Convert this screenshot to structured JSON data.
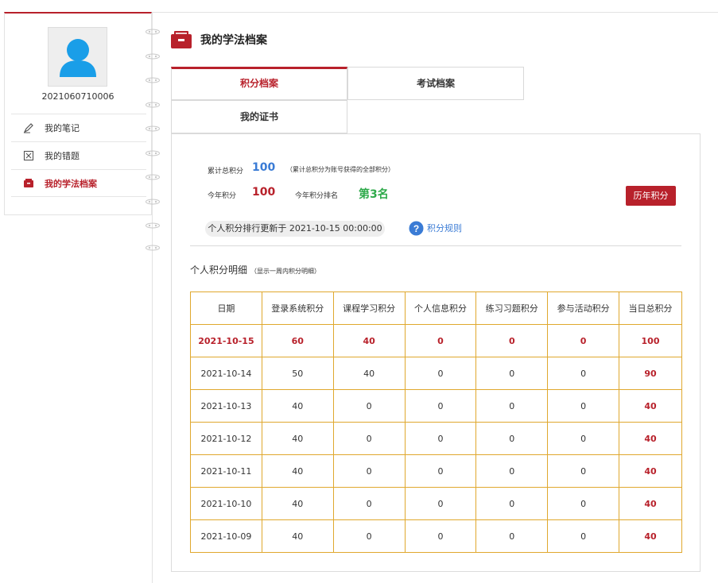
{
  "sidebar": {
    "user_id": "2021060710006",
    "menu": [
      {
        "label": "我的笔记",
        "icon": "pen-icon"
      },
      {
        "label": "我的错题",
        "icon": "wrong-answer-icon"
      },
      {
        "label": "我的学法档案",
        "icon": "archive-box-icon"
      }
    ],
    "active_index": 2
  },
  "header": {
    "title": "我的学法档案",
    "icon": "archive-box-icon"
  },
  "tabs": [
    {
      "label": "积分档案",
      "active": true
    },
    {
      "label": "考试档案",
      "active": false
    },
    {
      "label": "我的证书",
      "active": false
    }
  ],
  "stats": {
    "total_label": "累计总积分",
    "total_value": "100",
    "total_note": "（累计总积分为账号获得的全部积分）",
    "year_label": "今年积分",
    "year_value": "100",
    "rank_label": "今年积分排名",
    "rank_value": "第3名",
    "history_button": "历年积分",
    "update_text": "个人积分排行更新于  2021-10-15  00:00:00",
    "rule_link": "积分规则"
  },
  "detail": {
    "title": "个人积分明细",
    "subtitle": "（显示一周内积分明细）",
    "columns": [
      "日期",
      "登录系统积分",
      "课程学习积分",
      "个人信息积分",
      "练习习题积分",
      "参与活动积分",
      "当日总积分"
    ],
    "rows": [
      [
        "2021-10-15",
        "60",
        "40",
        "0",
        "0",
        "0",
        "100"
      ],
      [
        "2021-10-14",
        "50",
        "40",
        "0",
        "0",
        "0",
        "90"
      ],
      [
        "2021-10-13",
        "40",
        "0",
        "0",
        "0",
        "0",
        "40"
      ],
      [
        "2021-10-12",
        "40",
        "0",
        "0",
        "0",
        "0",
        "40"
      ],
      [
        "2021-10-11",
        "40",
        "0",
        "0",
        "0",
        "0",
        "40"
      ],
      [
        "2021-10-10",
        "40",
        "0",
        "0",
        "0",
        "0",
        "40"
      ],
      [
        "2021-10-09",
        "40",
        "0",
        "0",
        "0",
        "0",
        "40"
      ]
    ]
  },
  "colors": {
    "accent": "#b8212b",
    "blue": "#3a7bd5",
    "green": "#2eaa4a",
    "table_border": "#e0a82e"
  }
}
